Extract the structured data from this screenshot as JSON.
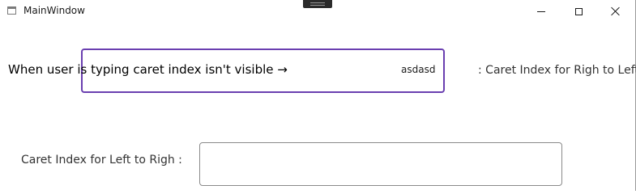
{
  "window": {
    "title": "MainWindow",
    "icons": {
      "app": "window-app-icon",
      "minimize": "minimize-icon",
      "maximize": "maximize-icon",
      "close": "close-icon"
    }
  },
  "content": {
    "overlay_text": "When user is typing caret index isn't visible →",
    "rtl_textbox": {
      "value": "asdasd"
    },
    "rtl_label": ": Caret Index for Righ to Left",
    "ltr_label": "Caret Index for Left to Righ :",
    "ltr_textbox": {
      "value": ""
    }
  },
  "colors": {
    "focus_border": "#6a3fb0",
    "border": "#8a8a8a"
  }
}
